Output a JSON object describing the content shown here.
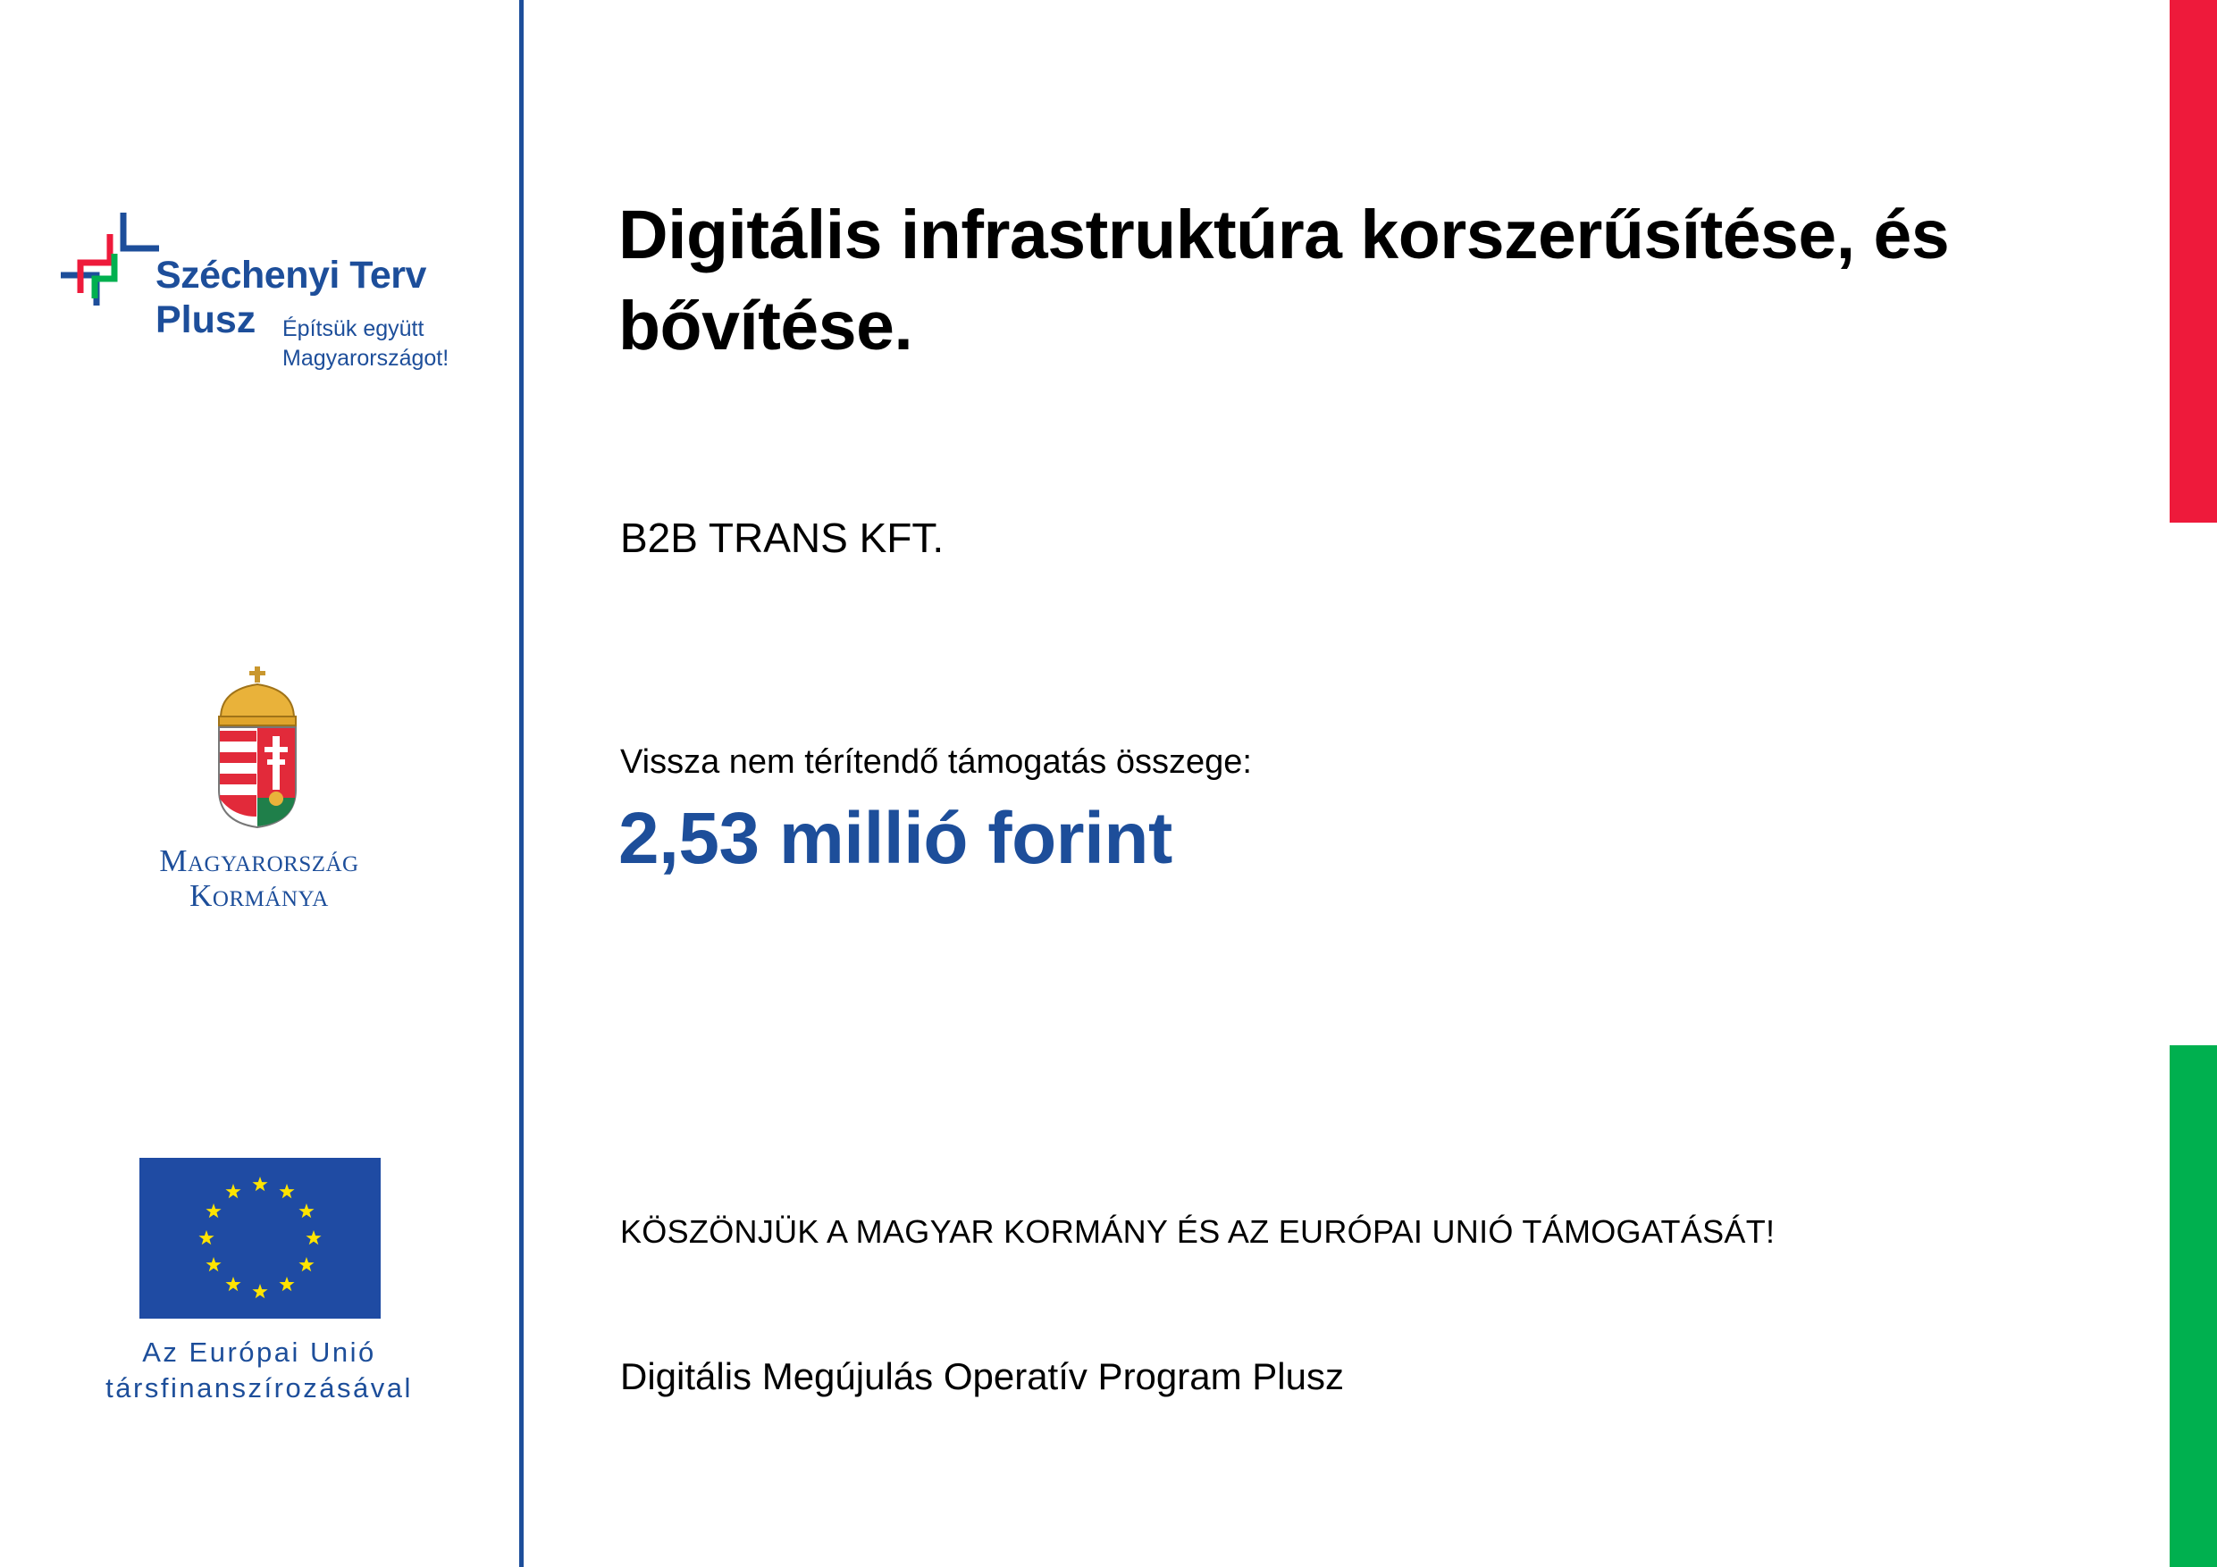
{
  "logos": {
    "szechenyi": {
      "name_line1": "Széchenyi Terv",
      "name_line2": "Plusz",
      "slogan": "Építsük együtt Magyarországot!",
      "colors": {
        "blue": "#1d4e9a",
        "red": "#ee1a3b",
        "green": "#00b04f"
      }
    },
    "government": {
      "line1": "Magyarország",
      "line2": "Kormánya"
    },
    "eu": {
      "flag_color": "#1f4ba3",
      "star_color": "#ffe400",
      "line1": "Az Európai Unió",
      "line2": "társfinanszírozásával"
    }
  },
  "main": {
    "title": "Digitális infrastruktúra korszerűsítése, és bővítése.",
    "beneficiary": "B2B TRANS KFT.",
    "support_label": "Vissza nem térítendő támogatás összege:",
    "support_amount": "2,53 millió forint",
    "thanks": "KÖSZÖNJÜK A MAGYAR KORMÁNY ÉS AZ EURÓPAI UNIÓ TÁMOGATÁSÁT!",
    "program": "Digitális Megújulás Operatív Program Plusz"
  },
  "colors": {
    "accent_blue": "#1d4e9a",
    "flag_red": "#ee1a3b",
    "flag_green": "#00b04f"
  }
}
